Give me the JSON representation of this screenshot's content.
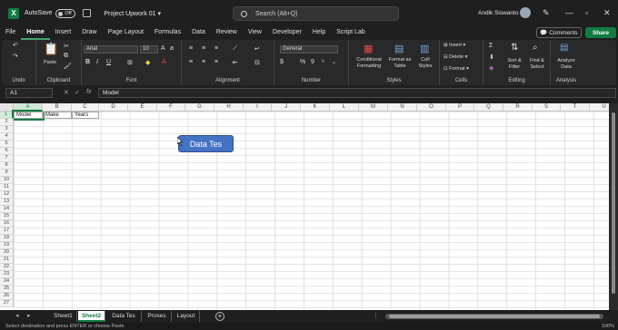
{
  "titlebar": {
    "autosave_label": "AutoSave",
    "autosave_state": "Off",
    "doc_title": "Project Upwork 01",
    "search_placeholder": "Search (Alt+Q)",
    "user_name": "Andik Siswanto"
  },
  "menu": [
    "File",
    "Home",
    "Insert",
    "Draw",
    "Page Layout",
    "Formulas",
    "Data",
    "Review",
    "View",
    "Developer",
    "Help",
    "Script Lab"
  ],
  "menu_active": "Home",
  "buttons": {
    "comments": "Comments",
    "share": "Share"
  },
  "ribbon": {
    "groups": [
      "Undo",
      "Clipboard",
      "Font",
      "Alignment",
      "Number",
      "Styles",
      "Cells",
      "Editing",
      "Analysis"
    ],
    "paste": "Paste",
    "font_name": "Arial",
    "font_size": "10",
    "number_format": "General",
    "conditional_formatting": "Conditional Formatting",
    "format_as_table": "Format as Table",
    "cell_styles": "Cell Styles",
    "insert": "Insert",
    "delete": "Delete",
    "format": "Format",
    "sort_filter": "Sort & Filter",
    "find_select": "Find & Select",
    "analyze_data": "Analyze Data"
  },
  "formula": {
    "namebox": "A1",
    "fx": "fx",
    "content": "Model"
  },
  "columns": [
    "A",
    "B",
    "C",
    "D",
    "E",
    "F",
    "G",
    "H",
    "I",
    "J",
    "K",
    "L",
    "M",
    "N",
    "O",
    "P",
    "Q",
    "R",
    "S",
    "T",
    "U"
  ],
  "rows": [
    "1",
    "2",
    "3",
    "4",
    "5",
    "6",
    "7",
    "8",
    "9",
    "10",
    "11",
    "12",
    "13",
    "14",
    "15",
    "16",
    "17",
    "18",
    "19",
    "20",
    "21",
    "22",
    "23",
    "24",
    "25",
    "26",
    "27"
  ],
  "cells": {
    "A1": "Model",
    "B1": "Make",
    "C1": "Years"
  },
  "shape_text": "Data Tes",
  "sheets": [
    "Sheet1",
    "Sheet2",
    "Data Tes",
    "Proses",
    "Layout"
  ],
  "active_sheet": "Sheet2",
  "status_text": "Select destination and press ENTER or choose Paste",
  "zoom": "100%"
}
